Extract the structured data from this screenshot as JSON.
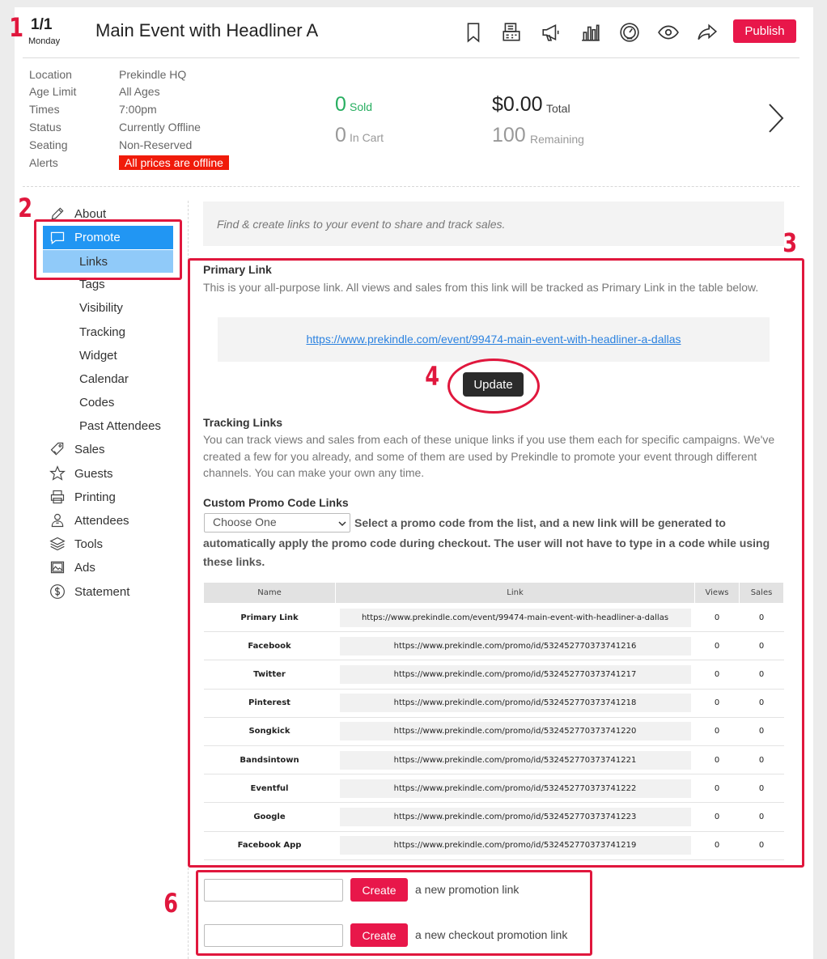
{
  "header": {
    "date_fraction": "1/1",
    "day": "Monday",
    "title": "Main Event with Headliner A",
    "publish_label": "Publish",
    "icons": [
      "bookmark-icon",
      "ticket-printer-icon",
      "megaphone-icon",
      "bar-chart-icon",
      "dashboard-gauge-icon",
      "eye-icon",
      "share-icon"
    ]
  },
  "info": {
    "rows": [
      {
        "label": "Location",
        "value": "Prekindle HQ"
      },
      {
        "label": "Age Limit",
        "value": "All Ages"
      },
      {
        "label": "Times",
        "value": "7:00pm"
      },
      {
        "label": "Status",
        "value": "Currently Offline"
      },
      {
        "label": "Seating",
        "value": "Non-Reserved"
      },
      {
        "label": "Alerts",
        "value": "All prices are offline"
      }
    ],
    "sold_count": "0",
    "sold_label": "Sold",
    "cart_count": "0",
    "cart_label": "In Cart",
    "total_amount": "$0.00",
    "total_label": "Total",
    "remaining_count": "100",
    "remaining_label": "Remaining"
  },
  "sidebar": {
    "about": "About",
    "promote": "Promote",
    "sub": [
      "Links",
      "Tags",
      "Visibility",
      "Tracking",
      "Widget",
      "Calendar",
      "Codes",
      "Past Attendees"
    ],
    "items": [
      "Sales",
      "Guests",
      "Printing",
      "Attendees",
      "Tools",
      "Ads",
      "Statement"
    ]
  },
  "content": {
    "intro": "Find & create links to your event to share and track sales.",
    "primary_title": "Primary Link",
    "primary_desc": "This is your all-purpose link. All views and sales from this link will be tracked as Primary Link in the table below.",
    "primary_url": "https://www.prekindle.com/event/99474-main-event-with-headliner-a-dallas",
    "update_label": "Update",
    "tracking_title": "Tracking Links",
    "tracking_desc": "You can track views and sales from each of these unique links if you use them each for specific campaigns. We've created a few for you already, and some of them are used by Prekindle to promote your event through different channels. You can make your own any time.",
    "custom_title": "Custom Promo Code Links",
    "select_value": "Choose One",
    "custom_desc_1": "Select a promo code from the list, and a new link will be generated to",
    "custom_desc_2": "automatically apply the promo code during checkout. The user will not have to type in a code while using these links.",
    "table": {
      "headers": [
        "Name",
        "Link",
        "Views",
        "Sales"
      ],
      "rows": [
        {
          "name": "Primary Link",
          "link": "https://www.prekindle.com/event/99474-main-event-with-headliner-a-dallas",
          "views": "0",
          "sales": "0"
        },
        {
          "name": "Facebook",
          "link": "https://www.prekindle.com/promo/id/532452770373741216",
          "views": "0",
          "sales": "0"
        },
        {
          "name": "Twitter",
          "link": "https://www.prekindle.com/promo/id/532452770373741217",
          "views": "0",
          "sales": "0"
        },
        {
          "name": "Pinterest",
          "link": "https://www.prekindle.com/promo/id/532452770373741218",
          "views": "0",
          "sales": "0"
        },
        {
          "name": "Songkick",
          "link": "https://www.prekindle.com/promo/id/532452770373741220",
          "views": "0",
          "sales": "0"
        },
        {
          "name": "Bandsintown",
          "link": "https://www.prekindle.com/promo/id/532452770373741221",
          "views": "0",
          "sales": "0"
        },
        {
          "name": "Eventful",
          "link": "https://www.prekindle.com/promo/id/532452770373741222",
          "views": "0",
          "sales": "0"
        },
        {
          "name": "Google",
          "link": "https://www.prekindle.com/promo/id/532452770373741223",
          "views": "0",
          "sales": "0"
        },
        {
          "name": "Facebook App",
          "link": "https://www.prekindle.com/promo/id/532452770373741219",
          "views": "0",
          "sales": "0"
        }
      ]
    },
    "create_label": "Create",
    "create_promo_text": "a new promotion link",
    "create_checkout_text": "a new checkout promotion link"
  },
  "annotations": [
    "1",
    "2",
    "3",
    "4",
    "6"
  ],
  "colors": {
    "accent": "#e8174a",
    "annotation": "#e0173d",
    "sidebar_active": "#2196f3",
    "sidebar_sub_active": "#90caf9",
    "sold_green": "#27ae60",
    "link_blue": "#2b82e0",
    "alert_red": "#f01b0a"
  }
}
